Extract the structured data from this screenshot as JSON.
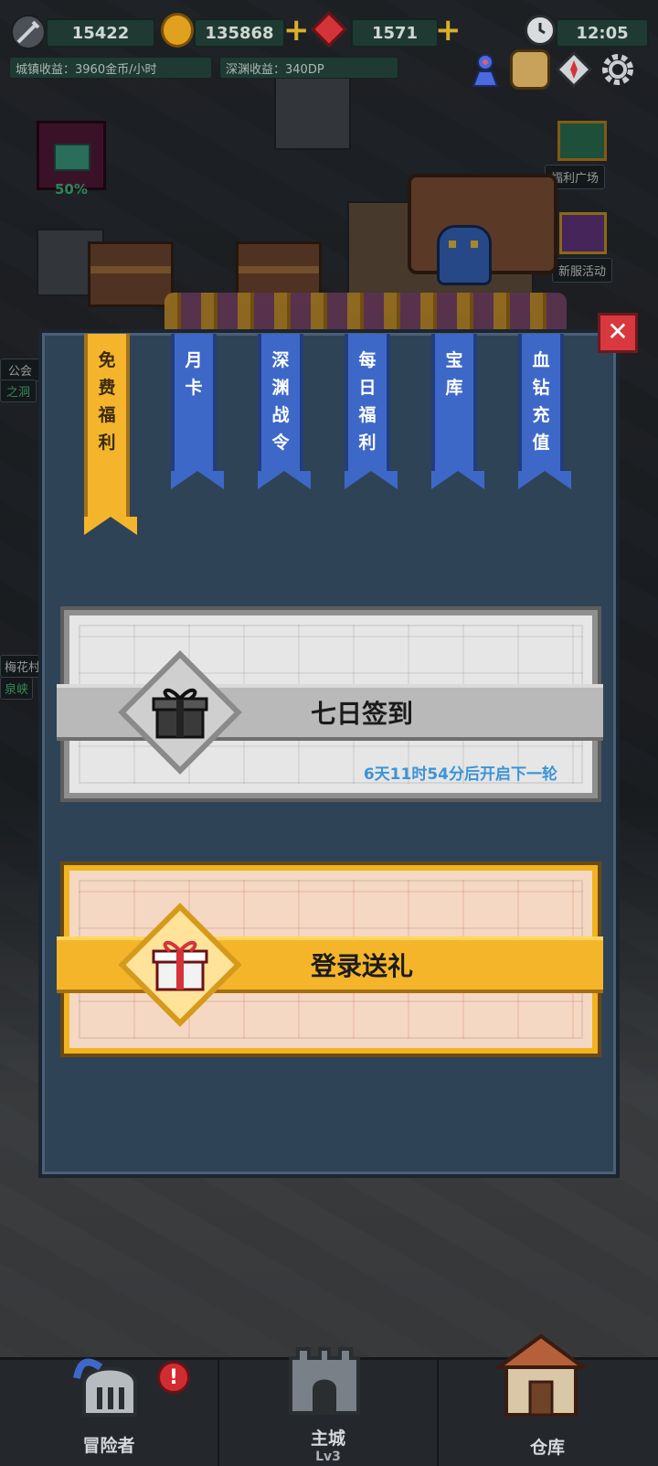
{
  "top_bar": {
    "sword_value": "15422",
    "gold_value": "135868",
    "gem_value": "1571",
    "time": "12:05",
    "town_income": "城镇收益：3960金币/小时",
    "abyss_income": "深渊收益：340DP"
  },
  "world": {
    "cube_progress": "50%",
    "welfare_plaza": "福利广场",
    "server_event": "新服活动",
    "side_labels": [
      "公会",
      "之洞",
      "梅花村",
      "泉峡"
    ]
  },
  "tabs": [
    {
      "label": "免\n费\n福\n利",
      "chars": [
        "免",
        "费",
        "福",
        "利"
      ],
      "active": true
    },
    {
      "label": "月卡",
      "chars": [
        "月",
        "卡"
      ],
      "active": false
    },
    {
      "label": "深渊战令",
      "chars": [
        "深",
        "渊",
        "战",
        "令"
      ],
      "active": false
    },
    {
      "label": "每日福利",
      "chars": [
        "每",
        "日",
        "福",
        "利"
      ],
      "active": false
    },
    {
      "label": "宝库",
      "chars": [
        "宝",
        "库"
      ],
      "active": false
    },
    {
      "label": "血钻充值",
      "chars": [
        "血",
        "钻",
        "充",
        "值"
      ],
      "active": false
    }
  ],
  "cards": {
    "seven_day": {
      "title": "七日签到",
      "countdown": "6天11时54分后开启下一轮"
    },
    "login_gift": {
      "title": "登录送礼"
    }
  },
  "bottom_nav": {
    "adventurer": "冒险者",
    "main_city": "主城",
    "main_city_level": "Lv3",
    "warehouse": "仓库",
    "alert": "!"
  },
  "colors": {
    "panel_bg": "#2f4356",
    "tab_blue": "#3e68c8",
    "tab_active": "#f4b52c",
    "countdown": "#3b94d6"
  }
}
